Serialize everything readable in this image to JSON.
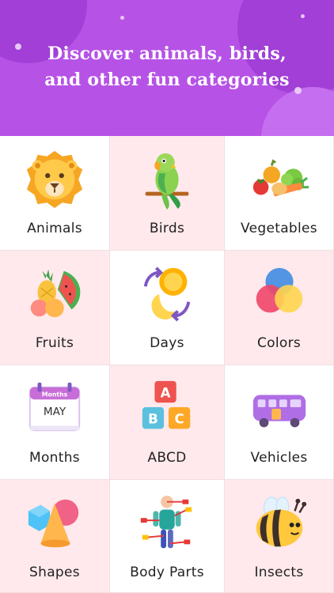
{
  "banner": {
    "headline_line1": "Discover animals, birds,",
    "headline_line2": "and other fun categories",
    "background": "#b652e6"
  },
  "categories": [
    {
      "label": "Animals",
      "icon": "lion-icon"
    },
    {
      "label": "Birds",
      "icon": "parrot-icon"
    },
    {
      "label": "Vegetables",
      "icon": "vegetables-icon"
    },
    {
      "label": "Fruits",
      "icon": "fruits-icon"
    },
    {
      "label": "Days",
      "icon": "day-night-icon"
    },
    {
      "label": "Colors",
      "icon": "color-circles-icon"
    },
    {
      "label": "Months",
      "icon": "calendar-icon"
    },
    {
      "label": "ABCD",
      "icon": "alphabet-blocks-icon"
    },
    {
      "label": "Vehicles",
      "icon": "bus-icon"
    },
    {
      "label": "Shapes",
      "icon": "shapes-icon"
    },
    {
      "label": "Body Parts",
      "icon": "body-parts-icon"
    },
    {
      "label": "Insects",
      "icon": "bee-icon"
    }
  ],
  "calendar_icon_text": {
    "header": "Months",
    "month": "MAY"
  },
  "blocks_icon_text": {
    "a": "A",
    "b": "B",
    "c": "C"
  },
  "colors": {
    "tile_white": "#ffffff",
    "tile_pink": "#ffe9ec",
    "divider": "#f1dfe2"
  }
}
